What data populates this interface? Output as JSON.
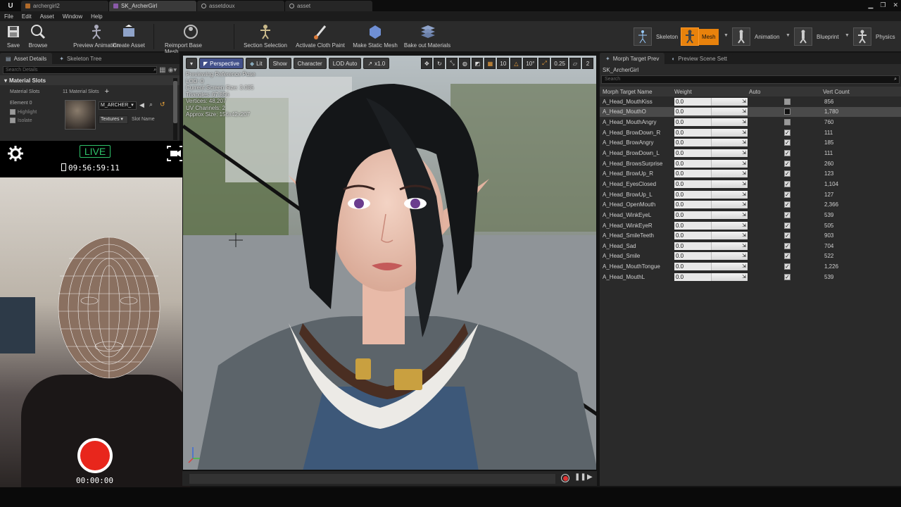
{
  "doc_tabs": [
    {
      "label": "archergirl2",
      "icon": "orange"
    },
    {
      "label": "SK_ArcherGirl",
      "icon": "purple"
    },
    {
      "label": "assetdoux",
      "icon": "circle"
    },
    {
      "label": "asset",
      "icon": "circle"
    }
  ],
  "menu": [
    "File",
    "Edit",
    "Asset",
    "Window",
    "Help"
  ],
  "toolbar": {
    "save": "Save",
    "browse": "Browse",
    "preview_animation": "Preview Animation",
    "create_asset": "Create Asset",
    "reimport": "Reimport Base Mesh",
    "section_selection": "Section Selection",
    "activate_cloth": "Activate Cloth Paint",
    "make_static": "Make Static Mesh",
    "bake_out": "Bake out Materials"
  },
  "modes": {
    "skeleton": "Skeleton",
    "mesh": "Mesh",
    "animation": "Animation",
    "blueprint": "Blueprint",
    "physics": "Physics"
  },
  "left_panel": {
    "tab_details": "Asset Details",
    "tab_skeleton": "Skeleton Tree",
    "search_placeholder": "Search Details",
    "section": "Material Slots",
    "slots_label": "Material Slots",
    "slots_count": "11 Material Slots",
    "element": "Element 0",
    "highlight": "Highlight",
    "isolate": "Isolate",
    "material_name": "M_ARCHER_",
    "textures": "Textures",
    "slot_name": "Slot Name"
  },
  "webcam": {
    "live": "LIVE",
    "clock": "09:56:59:11",
    "record_time": "00:00:00"
  },
  "viewport": {
    "perspective": "Perspective",
    "lit": "Lit",
    "show": "Show",
    "character": "Character",
    "lod": "LOD Auto",
    "speed": "x1.0",
    "grid_val": "10",
    "angle_val": "10°",
    "scale_val": "0.25",
    "cams": "2",
    "stats": [
      "Previewing Reference Pose",
      "LOD: 0",
      "Current Screen Size: 3.085",
      "Triangles: 67,856",
      "Vertices: 48,207",
      "UV Channels: 2",
      "Approx Size: 156x42x207"
    ]
  },
  "right_panel": {
    "tab_morph": "Morph Target Prev",
    "tab_scene": "Preview Scene Sett",
    "asset_name": "SK_ArcherGirl",
    "search_placeholder": "Search",
    "col_name": "Morph Target Name",
    "col_weight": "Weight",
    "col_auto": "Auto",
    "col_verts": "Vert Count",
    "rows": [
      {
        "name": "A_Head_MouthKiss",
        "weight": "0.0",
        "auto": "off",
        "verts": "856"
      },
      {
        "name": "A_Head_MouthO",
        "weight": "0.0",
        "auto": "dark",
        "verts": "1,780"
      },
      {
        "name": "A_Head_MouthAngry",
        "weight": "0.0",
        "auto": "off",
        "verts": "760"
      },
      {
        "name": "A_Head_BrowDown_R",
        "weight": "0.0",
        "auto": "on",
        "verts": "111"
      },
      {
        "name": "A_Head_BrowAngry",
        "weight": "0.0",
        "auto": "on",
        "verts": "185"
      },
      {
        "name": "A_Head_BrowDown_L",
        "weight": "0.0",
        "auto": "on",
        "verts": "111"
      },
      {
        "name": "A_Head_BrowsSurprise",
        "weight": "0.0",
        "auto": "on",
        "verts": "260"
      },
      {
        "name": "A_Head_BrowUp_R",
        "weight": "0.0",
        "auto": "on",
        "verts": "123"
      },
      {
        "name": "A_Head_EyesClosed",
        "weight": "0.0",
        "auto": "on",
        "verts": "1,104"
      },
      {
        "name": "A_Head_BrowUp_L",
        "weight": "0.0",
        "auto": "on",
        "verts": "127"
      },
      {
        "name": "A_Head_OpenMouth",
        "weight": "0.0",
        "auto": "on",
        "verts": "2,366"
      },
      {
        "name": "A_Head_WinkEyeL",
        "weight": "0.0",
        "auto": "on",
        "verts": "539"
      },
      {
        "name": "A_Head_WinkEyeR",
        "weight": "0.0",
        "auto": "on",
        "verts": "505"
      },
      {
        "name": "A_Head_SmileTeeth",
        "weight": "0.0",
        "auto": "on",
        "verts": "903"
      },
      {
        "name": "A_Head_Sad",
        "weight": "0.0",
        "auto": "on",
        "verts": "704"
      },
      {
        "name": "A_Head_Smile",
        "weight": "0.0",
        "auto": "on",
        "verts": "522"
      },
      {
        "name": "A_Head_MouthTongue",
        "weight": "0.0",
        "auto": "on",
        "verts": "1,226"
      },
      {
        "name": "A_Head_MouthL",
        "weight": "0.0",
        "auto": "on",
        "verts": "539"
      }
    ]
  },
  "colors": {
    "accent": "#e8820c",
    "live_green": "#2fc26a",
    "record_red": "#e8261c"
  }
}
